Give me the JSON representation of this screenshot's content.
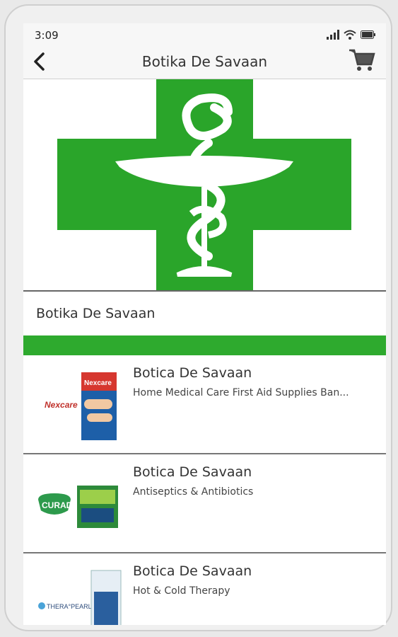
{
  "status_bar": {
    "time": "3:09"
  },
  "app_bar": {
    "title": "Botika De Savaan",
    "back_icon": "back-arrow-icon",
    "cart_icon": "cart-icon"
  },
  "store": {
    "name": "Botika De Savaan",
    "accent_color": "#2eaa2e"
  },
  "items": [
    {
      "title": "Botica De Savaan",
      "subtitle": "Home Medical Care First Aid Supplies Ban...",
      "thumb_brand": "Nexcare"
    },
    {
      "title": "Botica De Savaan",
      "subtitle": "Antiseptics & Antibiotics",
      "thumb_brand": "CURAD"
    },
    {
      "title": "Botica De Savaan",
      "subtitle": "Hot & Cold Therapy",
      "thumb_brand": "THERAPEARL"
    }
  ]
}
